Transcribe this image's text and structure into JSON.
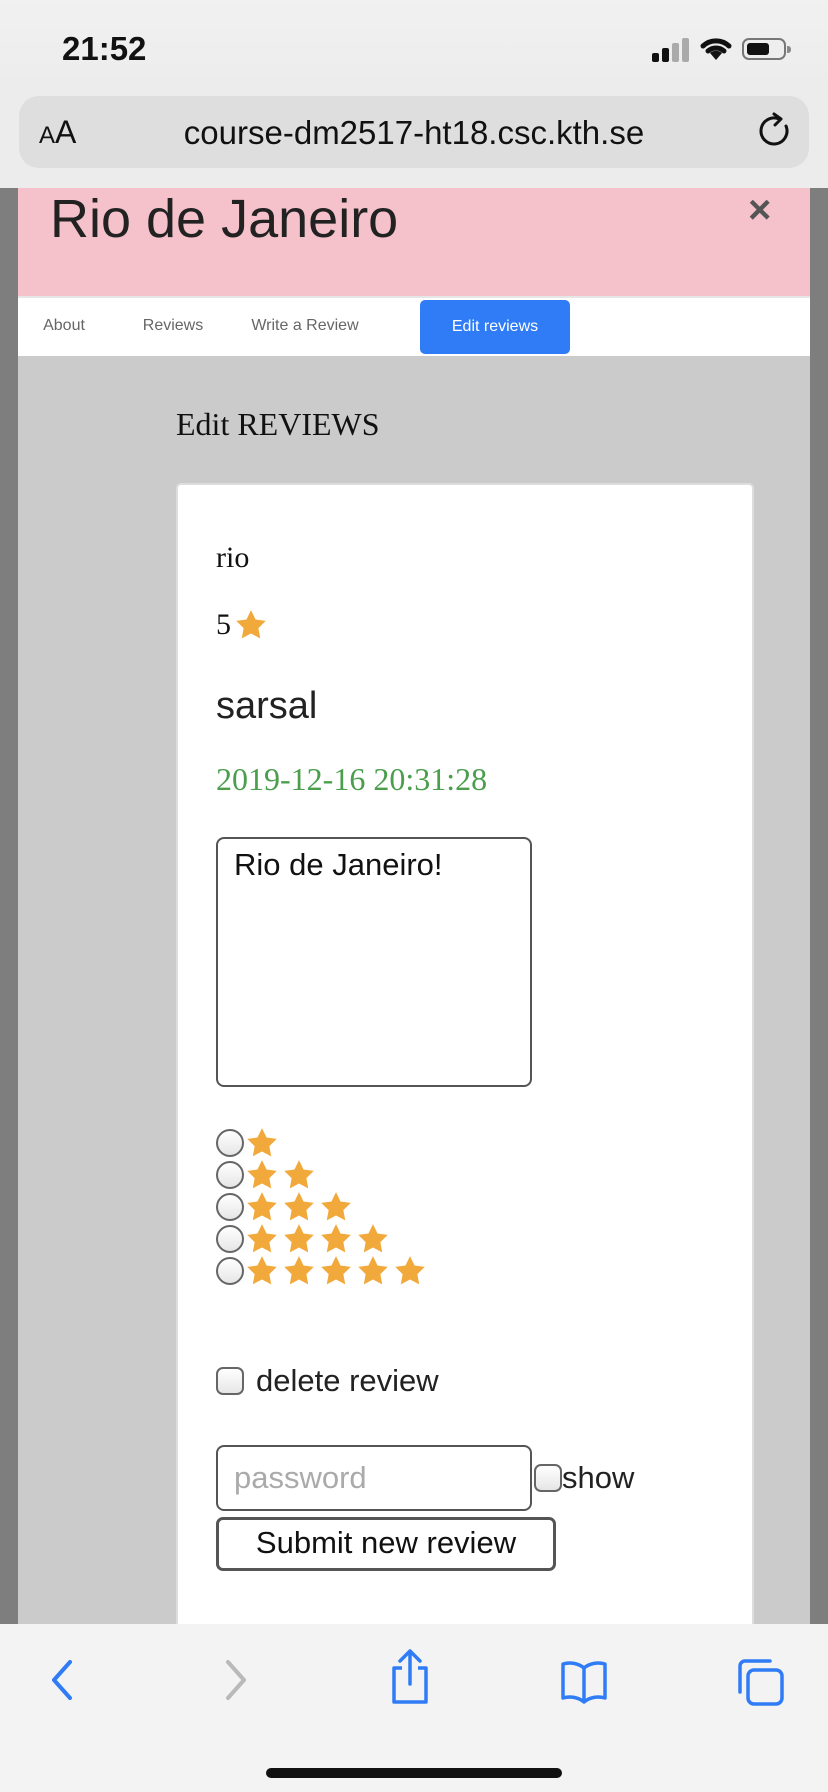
{
  "status_bar": {
    "time": "21:52"
  },
  "browser": {
    "aa_label": "AA",
    "url": "course-dm2517-ht18.csc.kth.se"
  },
  "site": {
    "title": "Rio de Janeiro",
    "close_symbol": "×",
    "tabs": [
      {
        "label": "About",
        "active": false
      },
      {
        "label": "Reviews",
        "active": false
      },
      {
        "label": "Write a Review",
        "active": false
      },
      {
        "label": "Edit reviews",
        "active": true
      }
    ]
  },
  "main": {
    "section_title": "Edit REVIEWS",
    "review": {
      "place": "rio",
      "rating": "5",
      "username": "sarsal",
      "date": "2019-12-16 20:31:28",
      "text": "Rio de Janeiro!"
    },
    "star_options": [
      1,
      2,
      3,
      4,
      5
    ],
    "delete_label": "delete review",
    "password_placeholder": "password",
    "show_label": "show",
    "submit_label": "Submit new review"
  },
  "colors": {
    "star": "#f2a93b",
    "header_bg": "#f5c1cb",
    "active_tab": "#2f7cf6",
    "date_green": "#4a9e4c",
    "ios_blue": "#2f7cf6"
  },
  "icons": [
    "signal-icon",
    "wifi-icon",
    "battery-icon",
    "reload-icon",
    "close-icon",
    "star-icon",
    "back-icon",
    "forward-icon",
    "share-icon",
    "bookmarks-icon",
    "tabs-icon"
  ]
}
